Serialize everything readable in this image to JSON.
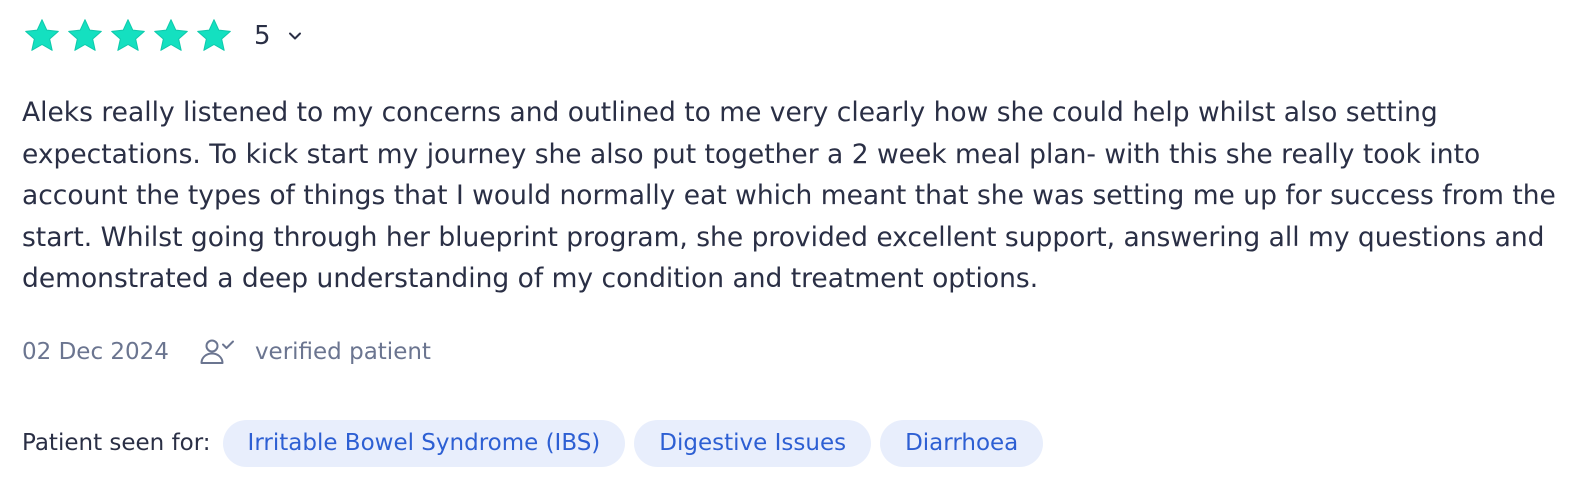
{
  "rating": {
    "value": "5",
    "stars_filled": 5,
    "stars_total": 5,
    "star_color": "#14e0c0",
    "dropdown_icon": "chevron-down-icon"
  },
  "review": {
    "text": "Aleks really listened to my concerns and outlined to me very clearly how she could help whilst also setting expectations. To kick start my journey she also put together a 2 week meal plan- with this she really took into account the types of things that I would normally eat which meant that she was setting me up for success from the start. Whilst going through her blueprint program, she provided excellent support, answering all my questions and demonstrated a deep understanding of my condition and treatment options."
  },
  "meta": {
    "date": "02 Dec 2024",
    "verified_icon": "user-check-icon",
    "verified_label": "verified patient"
  },
  "seen_for": {
    "label": "Patient seen for:",
    "conditions": [
      "Irritable Bowel Syndrome (IBS)",
      "Digestive Issues",
      "Diarrhoea"
    ],
    "chip_bg": "#e8eefc",
    "chip_text_color": "#2d5fd3"
  }
}
